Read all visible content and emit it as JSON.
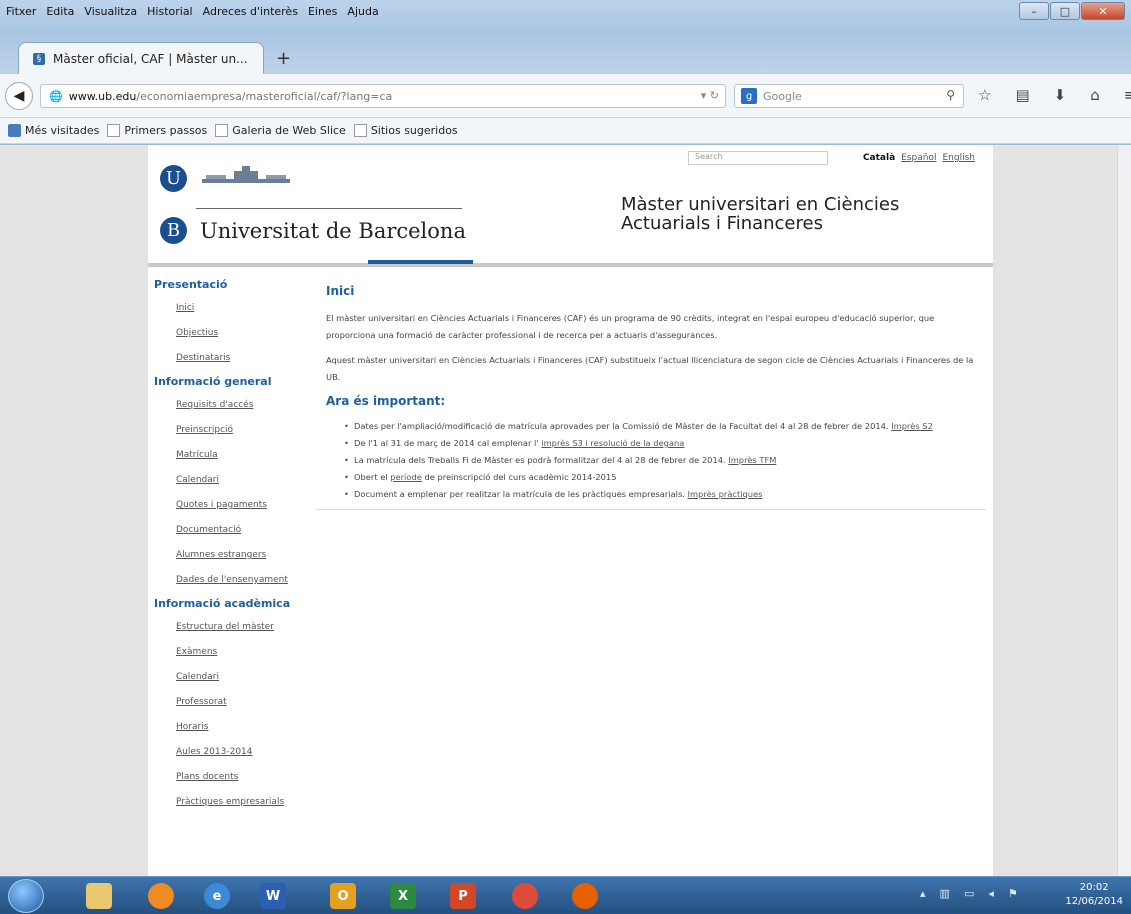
{
  "browser": {
    "menu": [
      "Fitxer",
      "Edita",
      "Visualitza",
      "Historial",
      "Adreces d'interès",
      "Eines",
      "Ajuda"
    ],
    "tab_title": "Màster oficial, CAF | Màster un...",
    "url_domain": "www.ub.edu",
    "url_path": "/economiaempresa/masteroficial/caf/?lang=ca",
    "search_placeholder": "Google",
    "bookmarks": [
      "Més visitades",
      "Primers passos",
      "Galeria de Web Slice",
      "Sitios sugeridos"
    ]
  },
  "site": {
    "university": "Universitat de Barcelona",
    "master_title_1": "Màster universitari en Ciències",
    "master_title_2": "Actuarials i Financeres",
    "search_placeholder": "Search",
    "languages": [
      "Català",
      "Español",
      "English"
    ]
  },
  "sidebar": {
    "sections": [
      {
        "title": "Presentació",
        "items": [
          "Inici",
          "Objectius",
          "Destinataris"
        ]
      },
      {
        "title": "Informació general",
        "items": [
          "Requisits d'accés",
          "Preinscripció",
          "Matrícula",
          "Calendari",
          "Quotes i pagaments",
          "Documentació",
          "Alumnes estrangers",
          "Dades de l'ensenyament"
        ]
      },
      {
        "title": "Informació acadèmica",
        "items": [
          "Estructura del màster",
          "Exàmens",
          "Calendari",
          "Professorat",
          "Horaris",
          "Aules 2013-2014",
          "Plans docents",
          "Pràctiques empresarials"
        ]
      }
    ]
  },
  "content": {
    "heading": "Inici",
    "p1": "El màster universitari en Ciències Actuarials i Financeres (CAF) és un programa de 90 crèdits, integrat en l'espai europeu d'educació superior, que proporciona una formació de caràcter professional i de recerca per a actuaris d'assegurances.",
    "p2": "Aquest màster universitari en Ciències Actuarials i Financeres (CAF) substitueix l'actual llicenciatura de segon cicle de Ciències Actuarials i Financeres de la UB.",
    "important": "Ara és important:",
    "bullets": [
      {
        "text": "Dates per l'ampliació/modificació de matrícula aprovades per la Comissió de Màster de la Facultat del 4 al 28 de febrer de 2014. ",
        "link": "Imprès S2"
      },
      {
        "text": "De l'1 al 31 de març de 2014 cal emplenar l' ",
        "link": "imprès S3 i resolució de la degana"
      },
      {
        "text": "La matrícula dels Treballs Fi de Màster es podrà formalitzar del 4 al 28 de febrer de 2014. ",
        "link": "Imprès TFM"
      },
      {
        "text": "Obert el ",
        "link": "període",
        "after": " de preinscripció del curs acadèmic 2014-2015"
      },
      {
        "text": "Document a emplenar per realitzar la matrícula de les pràctiques empresarials. ",
        "link": "Imprès pràctiques"
      }
    ]
  },
  "taskbar": {
    "time": "20:02",
    "date": "12/06/2014"
  },
  "colors": {
    "ub_blue": "#1b4e8e",
    "section_blue": "#1f5fa0"
  }
}
